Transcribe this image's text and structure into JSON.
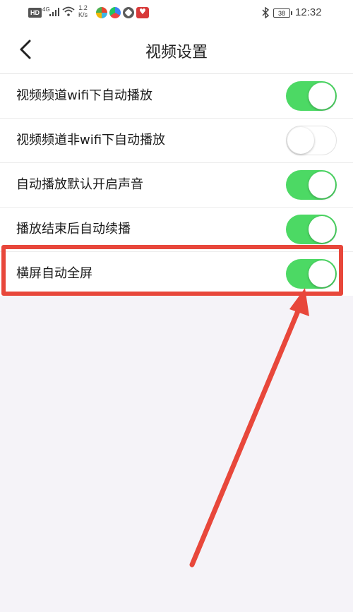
{
  "status_bar": {
    "hd_badge": "HD",
    "network_type": "4G",
    "speed_value": "1.2",
    "speed_unit": "K/s",
    "battery": "38",
    "time": "12:32"
  },
  "nav": {
    "title": "视频设置",
    "back_icon": "chevron-left-icon"
  },
  "settings": [
    {
      "label": "视频频道wifi下自动播放",
      "enabled": true
    },
    {
      "label": "视频频道非wifi下自动播放",
      "enabled": false
    },
    {
      "label": "自动播放默认开启声音",
      "enabled": true
    },
    {
      "label": "播放结束后自动续播",
      "enabled": true
    },
    {
      "label": "横屏自动全屏",
      "enabled": true
    }
  ],
  "annotation": {
    "highlight_color": "#e8473b",
    "highlighted_setting": "横屏自动全屏"
  },
  "colors": {
    "toggle_on": "#4cd964",
    "background": "#f5f3f8"
  }
}
